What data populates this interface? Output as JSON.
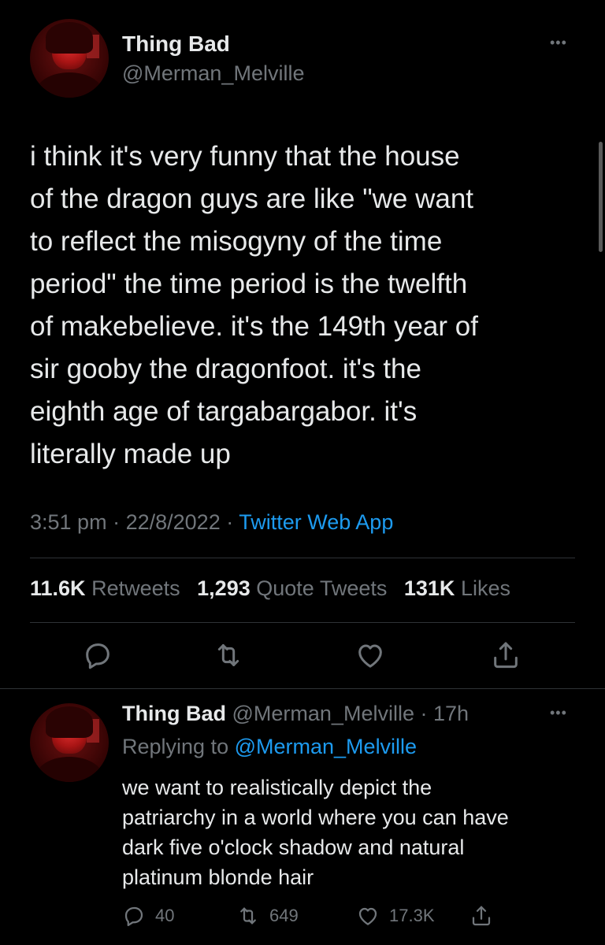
{
  "colors": {
    "background": "#000000",
    "text_primary": "#e7e9ea",
    "text_secondary": "#71767b",
    "link": "#1d9bf0",
    "divider": "#2f3336"
  },
  "main_tweet": {
    "display_name": "Thing Bad",
    "handle": "@Merman_Melville",
    "text": "i think it's very funny that the house\nof the dragon guys are like \"we want\nto reflect the misogyny of the time\nperiod\" the time period is the twelfth\nof makebelieve. it's the 149th year of\nsir gooby the dragonfoot. it's the\neighth age of targabargabor. it's\nliterally made up",
    "time": "3:51 pm",
    "date": "22/8/2022",
    "separator": "·",
    "source": "Twitter Web App",
    "stats": {
      "retweets_count": "11.6K",
      "retweets_label": "Retweets",
      "quote_count": "1,293",
      "quote_label": "Quote Tweets",
      "likes_count": "131K",
      "likes_label": "Likes"
    },
    "actions": {
      "reply_icon": "reply-icon",
      "retweet_icon": "retweet-icon",
      "like_icon": "heart-icon",
      "share_icon": "share-icon"
    }
  },
  "reply_tweet": {
    "display_name": "Thing Bad",
    "handle": "@Merman_Melville",
    "separator": "·",
    "time_ago": "17h",
    "replying_prefix": "Replying to",
    "replying_to": "@Merman_Melville",
    "text": "we want to realistically depict the\npatriarchy in a world where you can have\ndark five o'clock shadow and natural\nplatinum blonde hair",
    "reply_count": "40",
    "retweet_count": "649",
    "like_count": "17.3K"
  },
  "more_glyph": "•••"
}
